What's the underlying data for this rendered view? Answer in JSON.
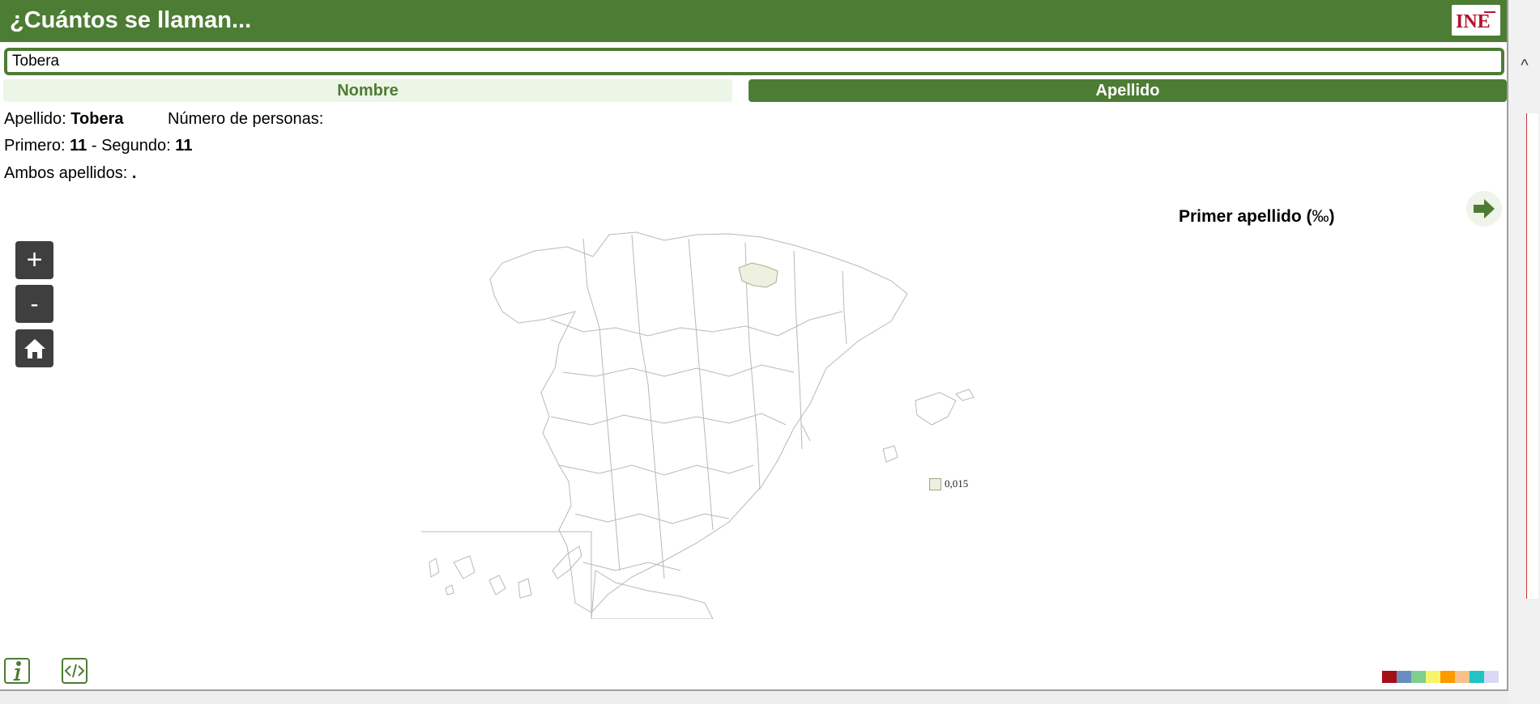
{
  "header": {
    "title": "¿Cuántos se llaman...",
    "logo_text": "INE"
  },
  "search": {
    "value": "Tobera"
  },
  "tabs": [
    {
      "label": "Nombre",
      "active": false
    },
    {
      "label": "Apellido",
      "active": true
    }
  ],
  "result": {
    "apellido_label": "Apellido:",
    "apellido_value": "Tobera",
    "personas_label": "Número de personas:",
    "primero_label": "Primero:",
    "primero_value": "11",
    "separator": "-",
    "segundo_label": "Segundo:",
    "segundo_value": "11",
    "ambos_label": "Ambos apellidos:",
    "ambos_value": "."
  },
  "map": {
    "title": "Primer apellido (",
    "unit": "‰",
    "title_close": ")",
    "legend_value": "0,015",
    "highlight_color": "#eef1df"
  },
  "controls": {
    "zoom_in": "+",
    "zoom_out": "-"
  },
  "palette": [
    "#a50f15",
    "#6b8cbf",
    "#7fcf8f",
    "#f6f46a",
    "#ff9900",
    "#f9c18a",
    "#20c4c4",
    "#d9d9f7"
  ],
  "colors": {
    "brand_green": "#4d7c34",
    "tab_inactive_bg": "#edf5e6"
  },
  "icons": {
    "home": "home-icon",
    "next": "arrow-right-icon",
    "info": "info-icon",
    "embed": "code-icon"
  }
}
